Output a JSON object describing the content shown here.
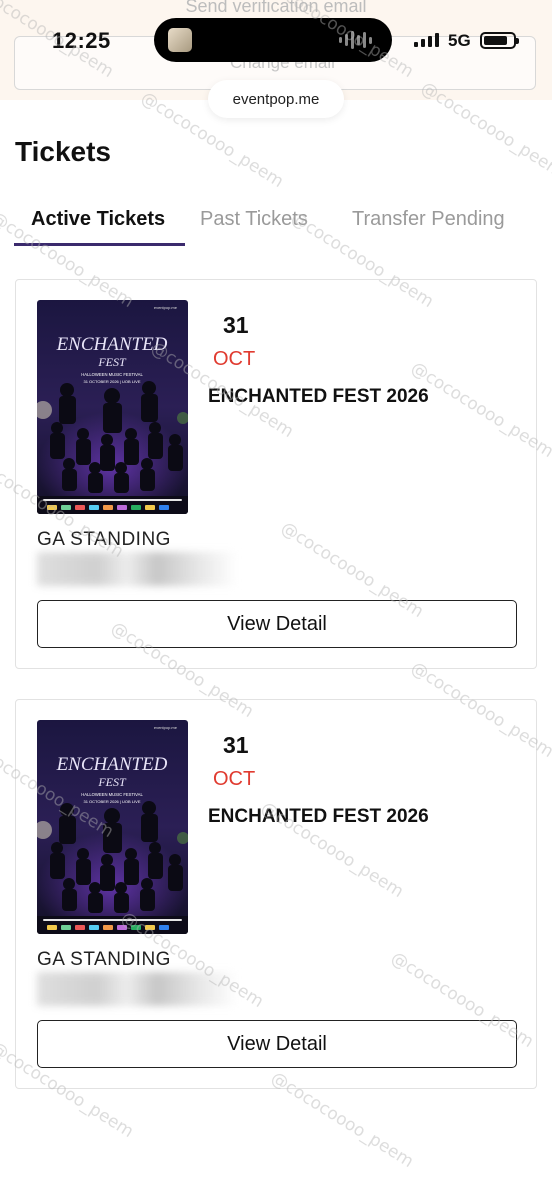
{
  "background_ui": {
    "send_verification": "Send verification email",
    "change_email": "Change email"
  },
  "status_bar": {
    "time": "12:25",
    "network": "5G",
    "icons": [
      "signal-bars-icon",
      "battery-icon",
      "audio-waveform-icon"
    ]
  },
  "browser": {
    "url": "eventpop.me"
  },
  "page": {
    "title": "Tickets"
  },
  "tabs": [
    {
      "label": "Active Tickets",
      "active": true
    },
    {
      "label": "Past Tickets",
      "active": false
    },
    {
      "label": "Transfer Pending",
      "active": false
    }
  ],
  "tickets": [
    {
      "day": "31",
      "month": "OCT",
      "event_name": "ENCHANTED FEST 2026",
      "zone": "GA STANDING",
      "button_label": "View Detail",
      "poster": {
        "title": "ENCHANTED",
        "subtitle": "FEST",
        "tagline": "HALLOWEEN MUSIC FESTIVAL",
        "date_venue": "31 OCTOBER 2026 | UOB LIVE",
        "brand": "eventpop.me"
      }
    },
    {
      "day": "31",
      "month": "OCT",
      "event_name": "ENCHANTED FEST 2026",
      "zone": "GA STANDING",
      "button_label": "View Detail",
      "poster": {
        "title": "ENCHANTED",
        "subtitle": "FEST",
        "tagline": "HALLOWEEN MUSIC FESTIVAL",
        "date_venue": "31 OCTOBER 2026 | UOB LIVE",
        "brand": "eventpop.me"
      }
    }
  ],
  "watermark": "@cococoooo_peem",
  "colors": {
    "accent_underline": "#3b2a6d",
    "month_red": "#e03b30",
    "inactive_tab": "#9a9a9a"
  }
}
